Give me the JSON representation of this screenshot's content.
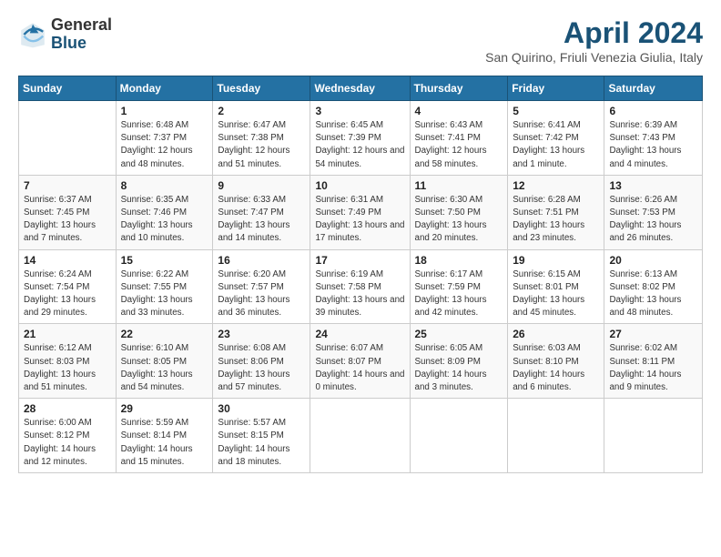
{
  "logo": {
    "general": "General",
    "blue": "Blue"
  },
  "title": "April 2024",
  "location": "San Quirino, Friuli Venezia Giulia, Italy",
  "weekdays": [
    "Sunday",
    "Monday",
    "Tuesday",
    "Wednesday",
    "Thursday",
    "Friday",
    "Saturday"
  ],
  "weeks": [
    [
      {
        "day": null
      },
      {
        "day": "1",
        "sunrise": "Sunrise: 6:48 AM",
        "sunset": "Sunset: 7:37 PM",
        "daylight": "Daylight: 12 hours and 48 minutes."
      },
      {
        "day": "2",
        "sunrise": "Sunrise: 6:47 AM",
        "sunset": "Sunset: 7:38 PM",
        "daylight": "Daylight: 12 hours and 51 minutes."
      },
      {
        "day": "3",
        "sunrise": "Sunrise: 6:45 AM",
        "sunset": "Sunset: 7:39 PM",
        "daylight": "Daylight: 12 hours and 54 minutes."
      },
      {
        "day": "4",
        "sunrise": "Sunrise: 6:43 AM",
        "sunset": "Sunset: 7:41 PM",
        "daylight": "Daylight: 12 hours and 58 minutes."
      },
      {
        "day": "5",
        "sunrise": "Sunrise: 6:41 AM",
        "sunset": "Sunset: 7:42 PM",
        "daylight": "Daylight: 13 hours and 1 minute."
      },
      {
        "day": "6",
        "sunrise": "Sunrise: 6:39 AM",
        "sunset": "Sunset: 7:43 PM",
        "daylight": "Daylight: 13 hours and 4 minutes."
      }
    ],
    [
      {
        "day": "7",
        "sunrise": "Sunrise: 6:37 AM",
        "sunset": "Sunset: 7:45 PM",
        "daylight": "Daylight: 13 hours and 7 minutes."
      },
      {
        "day": "8",
        "sunrise": "Sunrise: 6:35 AM",
        "sunset": "Sunset: 7:46 PM",
        "daylight": "Daylight: 13 hours and 10 minutes."
      },
      {
        "day": "9",
        "sunrise": "Sunrise: 6:33 AM",
        "sunset": "Sunset: 7:47 PM",
        "daylight": "Daylight: 13 hours and 14 minutes."
      },
      {
        "day": "10",
        "sunrise": "Sunrise: 6:31 AM",
        "sunset": "Sunset: 7:49 PM",
        "daylight": "Daylight: 13 hours and 17 minutes."
      },
      {
        "day": "11",
        "sunrise": "Sunrise: 6:30 AM",
        "sunset": "Sunset: 7:50 PM",
        "daylight": "Daylight: 13 hours and 20 minutes."
      },
      {
        "day": "12",
        "sunrise": "Sunrise: 6:28 AM",
        "sunset": "Sunset: 7:51 PM",
        "daylight": "Daylight: 13 hours and 23 minutes."
      },
      {
        "day": "13",
        "sunrise": "Sunrise: 6:26 AM",
        "sunset": "Sunset: 7:53 PM",
        "daylight": "Daylight: 13 hours and 26 minutes."
      }
    ],
    [
      {
        "day": "14",
        "sunrise": "Sunrise: 6:24 AM",
        "sunset": "Sunset: 7:54 PM",
        "daylight": "Daylight: 13 hours and 29 minutes."
      },
      {
        "day": "15",
        "sunrise": "Sunrise: 6:22 AM",
        "sunset": "Sunset: 7:55 PM",
        "daylight": "Daylight: 13 hours and 33 minutes."
      },
      {
        "day": "16",
        "sunrise": "Sunrise: 6:20 AM",
        "sunset": "Sunset: 7:57 PM",
        "daylight": "Daylight: 13 hours and 36 minutes."
      },
      {
        "day": "17",
        "sunrise": "Sunrise: 6:19 AM",
        "sunset": "Sunset: 7:58 PM",
        "daylight": "Daylight: 13 hours and 39 minutes."
      },
      {
        "day": "18",
        "sunrise": "Sunrise: 6:17 AM",
        "sunset": "Sunset: 7:59 PM",
        "daylight": "Daylight: 13 hours and 42 minutes."
      },
      {
        "day": "19",
        "sunrise": "Sunrise: 6:15 AM",
        "sunset": "Sunset: 8:01 PM",
        "daylight": "Daylight: 13 hours and 45 minutes."
      },
      {
        "day": "20",
        "sunrise": "Sunrise: 6:13 AM",
        "sunset": "Sunset: 8:02 PM",
        "daylight": "Daylight: 13 hours and 48 minutes."
      }
    ],
    [
      {
        "day": "21",
        "sunrise": "Sunrise: 6:12 AM",
        "sunset": "Sunset: 8:03 PM",
        "daylight": "Daylight: 13 hours and 51 minutes."
      },
      {
        "day": "22",
        "sunrise": "Sunrise: 6:10 AM",
        "sunset": "Sunset: 8:05 PM",
        "daylight": "Daylight: 13 hours and 54 minutes."
      },
      {
        "day": "23",
        "sunrise": "Sunrise: 6:08 AM",
        "sunset": "Sunset: 8:06 PM",
        "daylight": "Daylight: 13 hours and 57 minutes."
      },
      {
        "day": "24",
        "sunrise": "Sunrise: 6:07 AM",
        "sunset": "Sunset: 8:07 PM",
        "daylight": "Daylight: 14 hours and 0 minutes."
      },
      {
        "day": "25",
        "sunrise": "Sunrise: 6:05 AM",
        "sunset": "Sunset: 8:09 PM",
        "daylight": "Daylight: 14 hours and 3 minutes."
      },
      {
        "day": "26",
        "sunrise": "Sunrise: 6:03 AM",
        "sunset": "Sunset: 8:10 PM",
        "daylight": "Daylight: 14 hours and 6 minutes."
      },
      {
        "day": "27",
        "sunrise": "Sunrise: 6:02 AM",
        "sunset": "Sunset: 8:11 PM",
        "daylight": "Daylight: 14 hours and 9 minutes."
      }
    ],
    [
      {
        "day": "28",
        "sunrise": "Sunrise: 6:00 AM",
        "sunset": "Sunset: 8:12 PM",
        "daylight": "Daylight: 14 hours and 12 minutes."
      },
      {
        "day": "29",
        "sunrise": "Sunrise: 5:59 AM",
        "sunset": "Sunset: 8:14 PM",
        "daylight": "Daylight: 14 hours and 15 minutes."
      },
      {
        "day": "30",
        "sunrise": "Sunrise: 5:57 AM",
        "sunset": "Sunset: 8:15 PM",
        "daylight": "Daylight: 14 hours and 18 minutes."
      },
      {
        "day": null
      },
      {
        "day": null
      },
      {
        "day": null
      },
      {
        "day": null
      }
    ]
  ]
}
